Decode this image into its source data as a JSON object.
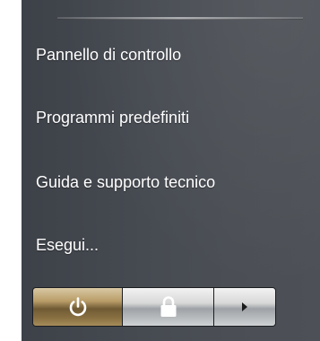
{
  "menu": {
    "items": [
      {
        "label": "Pannello di controllo"
      },
      {
        "label": "Programmi predefiniti"
      },
      {
        "label": "Guida e supporto tecnico"
      },
      {
        "label": "Esegui..."
      }
    ]
  },
  "buttons": {
    "power_icon": "power-icon",
    "lock_icon": "lock-icon",
    "arrow_icon": "arrow-right-icon"
  },
  "colors": {
    "panel_background": "#474b52",
    "text": "#ffffff",
    "power_button": "#b89c67"
  }
}
